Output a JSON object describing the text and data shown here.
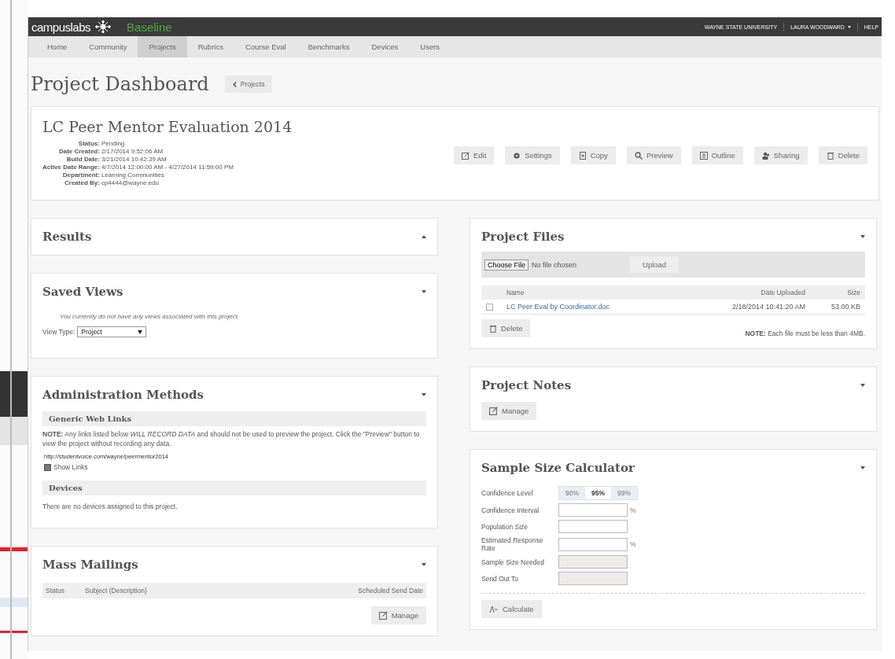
{
  "topbar": {
    "brand": "campuslabs",
    "product": "Baseline",
    "links": [
      {
        "label": "WAYNE STATE UNIVERSITY",
        "dropdown": false
      },
      {
        "label": "LAURA WOODWARD",
        "dropdown": true
      },
      {
        "label": "HELP",
        "dropdown": false
      }
    ]
  },
  "nav": [
    {
      "label": "Home",
      "selected": false
    },
    {
      "label": "Community",
      "selected": false
    },
    {
      "label": "Projects",
      "selected": true
    },
    {
      "label": "Rubrics",
      "selected": false
    },
    {
      "label": "Course Eval",
      "selected": false
    },
    {
      "label": "Benchmarks",
      "selected": false
    },
    {
      "label": "Devices",
      "selected": false
    },
    {
      "label": "Users",
      "selected": false
    }
  ],
  "page": {
    "title": "Project Dashboard",
    "back_button": "Projects"
  },
  "project": {
    "title": "LC Peer Mentor Evaluation 2014",
    "details": [
      {
        "label": "Status:",
        "value": "Pending"
      },
      {
        "label": "Date Created:",
        "value": "2/17/2014 9:52:06 AM"
      },
      {
        "label": "Build Date:",
        "value": "3/21/2014 10:42:39 AM"
      },
      {
        "label": "Active Date Range:",
        "value": "4/7/2014 12:00:00 AM - 4/27/2014 11:59:00 PM"
      },
      {
        "label": "Department:",
        "value": "Learning Communities"
      },
      {
        "label": "Created By:",
        "value": "cp4444@wayne.edu"
      }
    ],
    "actions": [
      {
        "kind": "edit",
        "label": "Edit"
      },
      {
        "kind": "settings",
        "label": "Settings"
      },
      {
        "kind": "copy",
        "label": "Copy"
      },
      {
        "kind": "preview",
        "label": "Preview"
      },
      {
        "kind": "outline",
        "label": "Outline"
      },
      {
        "kind": "sharing",
        "label": "Sharing"
      },
      {
        "kind": "delete",
        "label": "Delete"
      }
    ]
  },
  "results": {
    "title": "Results",
    "collapsed": true
  },
  "saved_views": {
    "title": "Saved Views",
    "collapsed": false,
    "message": "You currently do not have any views associated with this project.",
    "view_type_label": "View Type:",
    "view_type": "Project"
  },
  "administration_methods": {
    "title": "Administration Methods",
    "collapsed": false,
    "web_links_heading": "Generic Web Links",
    "note": "**NOTE:** Any links listed below *WILL RECORD DATA* and should not be used to preview the project. Click the \"Preview\" button to view the project without recording any data.",
    "link": "http://studentvoice.com/wayne/peermentor2014",
    "show_links": {
      "label": "Show Links",
      "checked": true
    },
    "devices_heading": "Devices",
    "devices_message": "There are no devices assigned to this project."
  },
  "mass_mailings": {
    "title": "Mass Mailings",
    "collapsed": false,
    "columns": [
      "Status",
      "Subject (Description)",
      "Scheduled Send Date"
    ],
    "manage_button": "Manage"
  },
  "project_files": {
    "title": "Project Files",
    "collapsed": false,
    "choose_file_button": "Choose File",
    "no_file_text": "No file chosen",
    "upload_button": "Upload",
    "columns": [
      "Name",
      "Date Uploaded",
      "Size"
    ],
    "files": [
      {
        "name": "LC Peer Eval by Coordinator.doc",
        "date_uploaded": "2/18/2014 10:41:20 AM",
        "size": "53.00 KB",
        "checked": false
      }
    ],
    "delete_button": "Delete",
    "note": "**NOTE:** Each file must be less than 4MB."
  },
  "project_notes": {
    "title": "Project Notes",
    "collapsed": false,
    "manage_button": "Manage"
  },
  "sample_size_calculator": {
    "title": "Sample Size Calculator",
    "collapsed": false,
    "confidence_level": {
      "label": "Confidence Level",
      "options": [
        {
          "label": "90%",
          "selected": false
        },
        {
          "label": "95%",
          "selected": true
        },
        {
          "label": "99%",
          "selected": false
        }
      ]
    },
    "fields": [
      {
        "label": "Confidence Interval",
        "unit": "%",
        "disabled": false
      },
      {
        "label": "Population Size",
        "disabled": false
      },
      {
        "label": "Estimated Response Rate",
        "unit": "%",
        "disabled": false
      },
      {
        "label": "Sample Size Needed",
        "disabled": true
      },
      {
        "label": "Send Out To",
        "disabled": true
      }
    ],
    "calculate_button": "Calculate"
  }
}
